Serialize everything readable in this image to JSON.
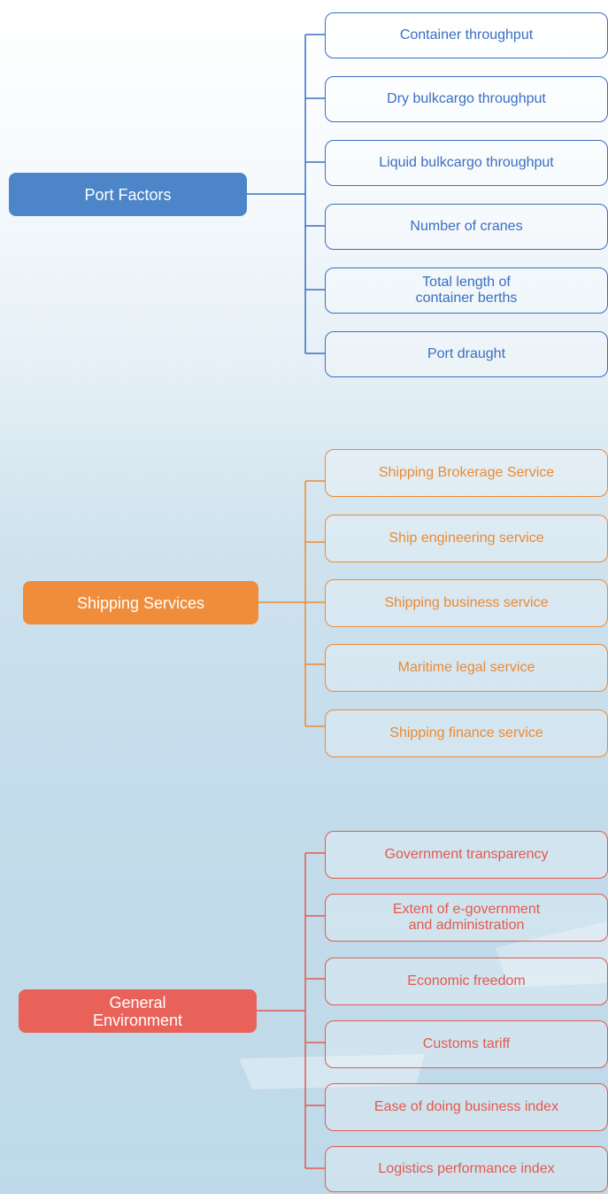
{
  "colors": {
    "port": "#3a6fc0",
    "shipping": "#ec8a33",
    "environment": "#e25a4e"
  },
  "groups": [
    {
      "category": "Port Factors",
      "items": [
        "Container throughput",
        "Dry bulkcargo throughput",
        "Liquid bulkcargo throughput",
        "Number of cranes",
        "Total length of\ncontainer berths",
        "Port draught"
      ]
    },
    {
      "category": "Shipping Services",
      "items": [
        "Shipping Brokerage Service",
        "Ship engineering service",
        "Shipping business service",
        "Maritime legal service",
        "Shipping finance service"
      ]
    },
    {
      "category": "General\nEnvironment",
      "items": [
        "Government transparency",
        "Extent of e-government\nand administration",
        "Economic freedom",
        "Customs tariff",
        "Ease of doing business index",
        "Logistics performance index"
      ]
    }
  ]
}
